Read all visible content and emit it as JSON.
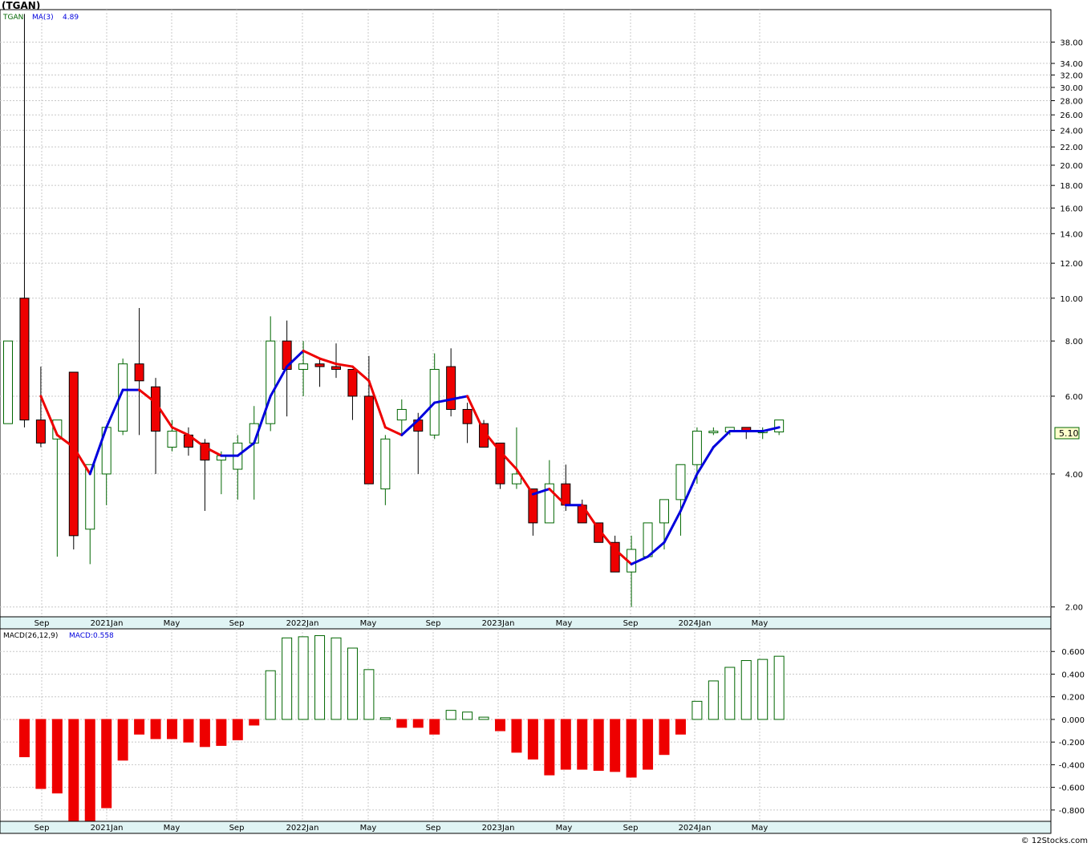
{
  "title": "(TGAN)",
  "credit": "© 12Stocks.com",
  "chart_data": [
    {
      "type": "candlestick",
      "ticker_label": "TGAN",
      "ma_label": "MA(3)",
      "ma_value": "4.89",
      "last_price_label": "5.10",
      "y_scale": "log",
      "ylim": [
        1.9,
        45
      ],
      "y_ticks": [
        2.0,
        4.0,
        6.0,
        8.0,
        10.0,
        12.0,
        14.0,
        16.0,
        18.0,
        20.0,
        22.0,
        24.0,
        26.0,
        28.0,
        30.0,
        32.0,
        34.0,
        38.0
      ],
      "x_ticks": [
        "Sep",
        "2021Jan",
        "May",
        "Sep",
        "2022Jan",
        "May",
        "Sep",
        "2023Jan",
        "May",
        "Sep",
        "2024Jan",
        "May"
      ],
      "grid": true,
      "up_color": "#ffffff",
      "down_color": "#ee0000",
      "wick_up_color": "#006600",
      "ma_up_color": "#0000dd",
      "ma_down_color": "#ee0000",
      "candles": [
        [
          5.2,
          8.0,
          5.2,
          8.0
        ],
        [
          10.0,
          44.0,
          5.1,
          5.3
        ],
        [
          5.3,
          7.0,
          4.6,
          4.7
        ],
        [
          4.8,
          5.3,
          2.6,
          5.3
        ],
        [
          6.8,
          6.8,
          2.7,
          2.9
        ],
        [
          3.0,
          4.2,
          2.5,
          4.2
        ],
        [
          4.0,
          5.1,
          3.4,
          5.1
        ],
        [
          5.0,
          7.3,
          4.9,
          7.1
        ],
        [
          7.1,
          9.5,
          4.9,
          6.5
        ],
        [
          6.3,
          6.6,
          4.0,
          5.0
        ],
        [
          4.6,
          5.3,
          4.5,
          5.0
        ],
        [
          4.9,
          5.1,
          4.4,
          4.6
        ],
        [
          4.7,
          4.8,
          3.3,
          4.3
        ],
        [
          4.3,
          4.5,
          3.6,
          4.4
        ],
        [
          4.1,
          4.9,
          3.5,
          4.7
        ],
        [
          4.7,
          5.7,
          3.5,
          5.2
        ],
        [
          5.2,
          9.1,
          5.0,
          8.0
        ],
        [
          8.0,
          8.9,
          5.4,
          6.9
        ],
        [
          6.9,
          8.0,
          6.0,
          7.1
        ],
        [
          7.1,
          7.3,
          6.3,
          7.0
        ],
        [
          7.0,
          7.9,
          6.6,
          6.9
        ],
        [
          6.9,
          6.9,
          5.3,
          6.0
        ],
        [
          6.0,
          7.4,
          4.7,
          3.8
        ],
        [
          3.7,
          4.9,
          3.4,
          4.8
        ],
        [
          5.3,
          5.9,
          4.9,
          5.6
        ],
        [
          5.3,
          5.5,
          4.0,
          5.0
        ],
        [
          4.9,
          7.5,
          4.8,
          6.9
        ],
        [
          7.0,
          7.7,
          5.4,
          5.6
        ],
        [
          5.6,
          5.8,
          4.7,
          5.2
        ],
        [
          5.2,
          5.3,
          4.6,
          4.6
        ],
        [
          4.7,
          4.7,
          3.7,
          3.8
        ],
        [
          3.8,
          5.1,
          3.7,
          4.0
        ],
        [
          3.7,
          3.7,
          2.9,
          3.1
        ],
        [
          3.1,
          4.3,
          3.1,
          3.8
        ],
        [
          3.8,
          4.2,
          3.3,
          3.4
        ],
        [
          3.4,
          3.5,
          3.1,
          3.1
        ],
        [
          3.1,
          3.1,
          2.8,
          2.8
        ],
        [
          2.8,
          2.9,
          2.4,
          2.4
        ],
        [
          2.4,
          2.9,
          2.0,
          2.7
        ],
        [
          2.6,
          3.1,
          2.7,
          3.1
        ],
        [
          3.1,
          3.2,
          2.7,
          3.5
        ],
        [
          3.5,
          4.0,
          2.9,
          4.2
        ],
        [
          4.2,
          5.1,
          3.8,
          5.0
        ],
        [
          5.0,
          5.1,
          4.9,
          5.0
        ],
        [
          4.98,
          5.1,
          4.9,
          5.1
        ],
        [
          5.1,
          5.1,
          4.8,
          5.0
        ],
        [
          4.98,
          5.1,
          4.8,
          5.0
        ],
        [
          4.98,
          5.3,
          4.9,
          5.3
        ]
      ],
      "ma": [
        null,
        null,
        6.0,
        4.9,
        4.6,
        4.0,
        5.1,
        6.2,
        6.2,
        5.8,
        5.1,
        4.9,
        4.6,
        4.4,
        4.4,
        4.7,
        6.0,
        7.0,
        7.6,
        7.3,
        7.1,
        7.0,
        6.5,
        5.1,
        4.9,
        5.3,
        5.8,
        5.9,
        6.0,
        5.0,
        4.5,
        4.1,
        3.6,
        3.7,
        3.4,
        3.4,
        3.0,
        2.7,
        2.5,
        2.6,
        2.8,
        3.3,
        4.0,
        4.6,
        5.0,
        5.0,
        5.0,
        5.1
      ]
    },
    {
      "type": "bar",
      "label": "MACD(26,12,9)",
      "value_label": "MACD:0.558",
      "ylim": [
        -0.9,
        0.8
      ],
      "y_ticks": [
        -0.8,
        -0.6,
        -0.4,
        -0.2,
        0.0,
        0.2,
        0.4,
        0.6
      ],
      "y_tick_labels": [
        "-0.800",
        "-0.600",
        "-0.400",
        "-0.200",
        "0.000",
        "0.200",
        "0.400",
        "0.600"
      ],
      "x_ticks": [
        "Sep",
        "2021Jan",
        "May",
        "Sep",
        "2022Jan",
        "May",
        "Sep",
        "2023Jan",
        "May",
        "Sep",
        "2024Jan",
        "May"
      ],
      "grid": true,
      "pos_color": "#006600",
      "neg_color": "#ee0000",
      "values": [
        null,
        -0.33,
        -0.61,
        -0.65,
        -0.97,
        -0.96,
        -0.78,
        -0.36,
        -0.13,
        -0.17,
        -0.17,
        -0.2,
        -0.24,
        -0.23,
        -0.18,
        -0.05,
        0.43,
        0.72,
        0.73,
        0.74,
        0.72,
        0.63,
        0.44,
        0.015,
        -0.07,
        -0.07,
        -0.13,
        0.08,
        0.065,
        0.02,
        -0.1,
        -0.29,
        -0.35,
        -0.49,
        -0.44,
        -0.44,
        -0.45,
        -0.46,
        -0.51,
        -0.44,
        -0.31,
        -0.13,
        0.16,
        0.34,
        0.46,
        0.52,
        0.53,
        0.558
      ]
    }
  ]
}
